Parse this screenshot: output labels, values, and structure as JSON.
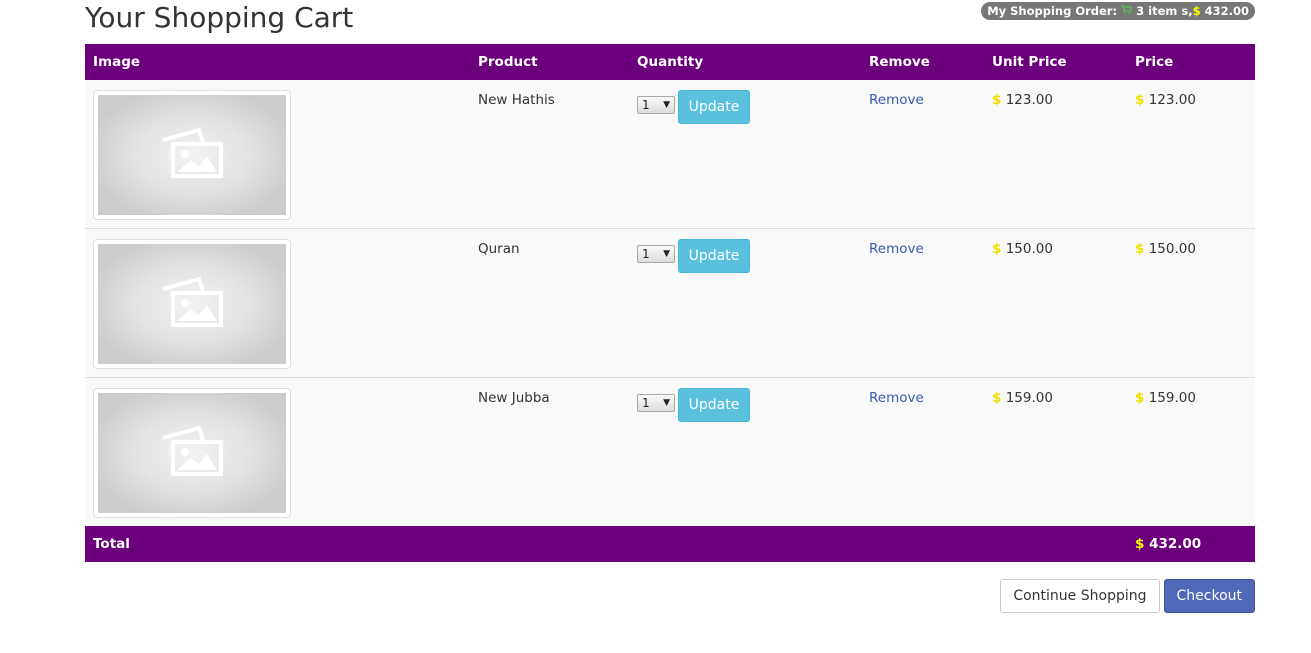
{
  "page": {
    "title": "Your Shopping Cart"
  },
  "order_badge": {
    "label": "My Shopping Order:",
    "items_text": "3 item s,",
    "currency": "$",
    "total": "432.00"
  },
  "table": {
    "headers": [
      "Image",
      "Product",
      "Quantity",
      "Remove",
      "Unit Price",
      "Price"
    ],
    "rows": [
      {
        "product": "New Hathis",
        "qty": "1",
        "update_label": "Update",
        "remove_label": "Remove",
        "unit_currency": "$",
        "unit_price": "123.00",
        "price_currency": "$",
        "price": "123.00",
        "image_icon": "image-placeholder-icon"
      },
      {
        "product": "Quran",
        "qty": "1",
        "update_label": "Update",
        "remove_label": "Remove",
        "unit_currency": "$",
        "unit_price": "150.00",
        "price_currency": "$",
        "price": "150.00",
        "image_icon": "image-placeholder-icon"
      },
      {
        "product": "New Jubba",
        "qty": "1",
        "update_label": "Update",
        "remove_label": "Remove",
        "unit_currency": "$",
        "unit_price": "159.00",
        "price_currency": "$",
        "price": "159.00",
        "image_icon": "image-placeholder-icon"
      }
    ],
    "footer": {
      "label": "Total",
      "currency": "$",
      "total": "432.00"
    }
  },
  "actions": {
    "continue_label": "Continue Shopping",
    "checkout_label": "Checkout"
  },
  "colors": {
    "header_bg": "#6c007c",
    "update_btn": "#5bc0de",
    "checkout_btn": "#4f68b7",
    "dollar": "#ffff00",
    "badge_bg": "#777777"
  }
}
